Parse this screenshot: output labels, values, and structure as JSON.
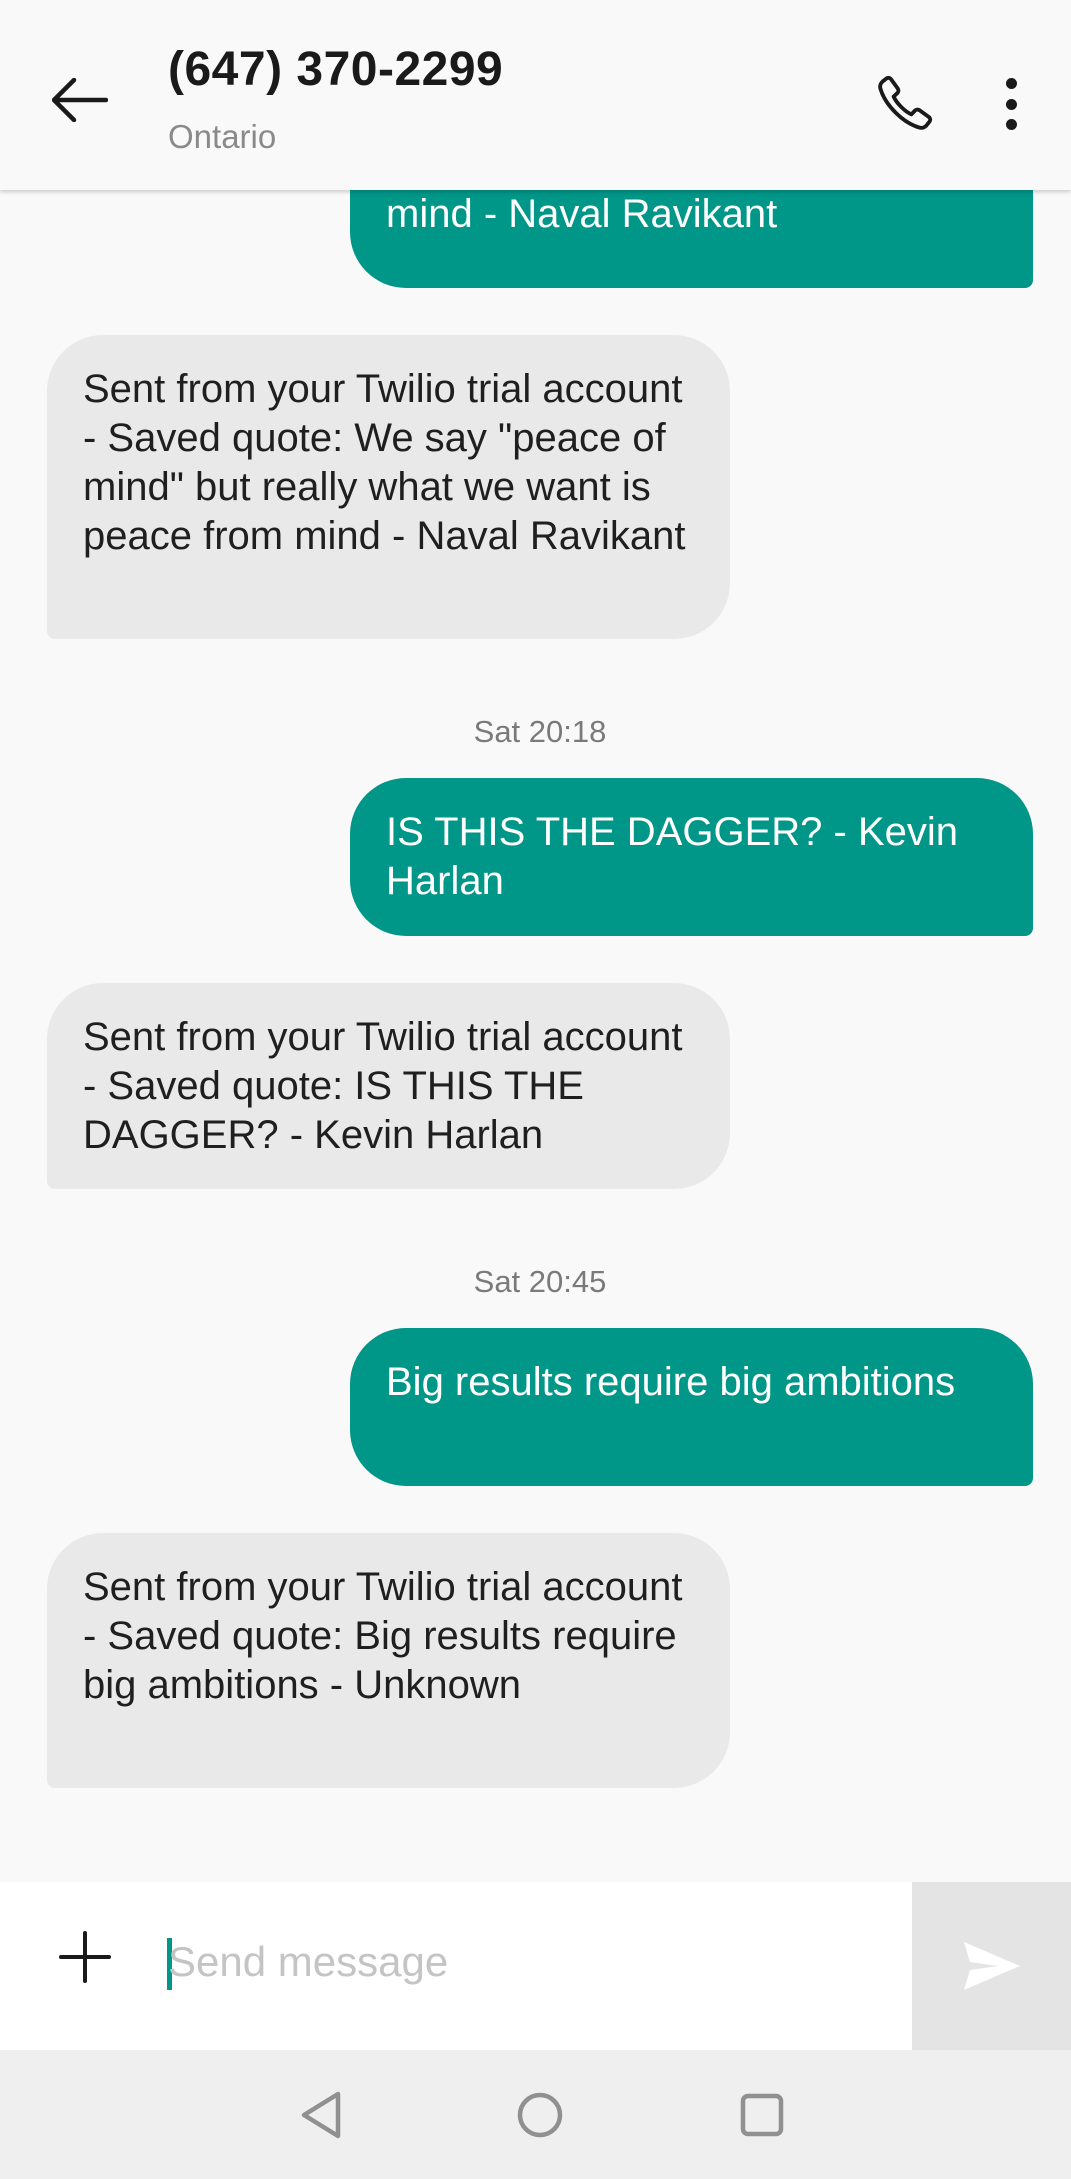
{
  "header": {
    "contact_name": "(647) 370-2299",
    "contact_location": "Ontario"
  },
  "messages": [
    {
      "direction": "outgoing",
      "text": "really what we want is peace from mind - Naval Ravikant"
    },
    {
      "direction": "incoming",
      "text": "Sent from your Twilio trial account - Saved quote: We say \"peace of mind\" but really what we want is peace from mind - Naval Ravikant"
    },
    {
      "type": "timestamp",
      "text": "Sat 20:18"
    },
    {
      "direction": "outgoing",
      "text": "IS THIS THE DAGGER? - Kevin Harlan"
    },
    {
      "direction": "incoming",
      "text": "Sent from your Twilio trial account - Saved quote: IS THIS THE DAGGER? - Kevin Harlan"
    },
    {
      "type": "timestamp",
      "text": "Sat 20:45"
    },
    {
      "direction": "outgoing",
      "text": "Big results require big ambitions"
    },
    {
      "direction": "incoming",
      "text": "Sent from your Twilio trial account - Saved quote: Big results require big ambitions - Unknown"
    }
  ],
  "compose": {
    "placeholder": "Send message",
    "value": ""
  },
  "icons": {
    "back": "arrow-left-icon",
    "call": "phone-icon",
    "menu": "more-vertical-icon",
    "attach": "plus-icon",
    "send": "send-icon",
    "nav_back": "triangle-back-icon",
    "nav_home": "circle-home-icon",
    "nav_recents": "square-recents-icon"
  },
  "colors": {
    "accent": "#009688",
    "incoming_bubble": "#e9e9e9",
    "background": "#f9f9f9"
  }
}
